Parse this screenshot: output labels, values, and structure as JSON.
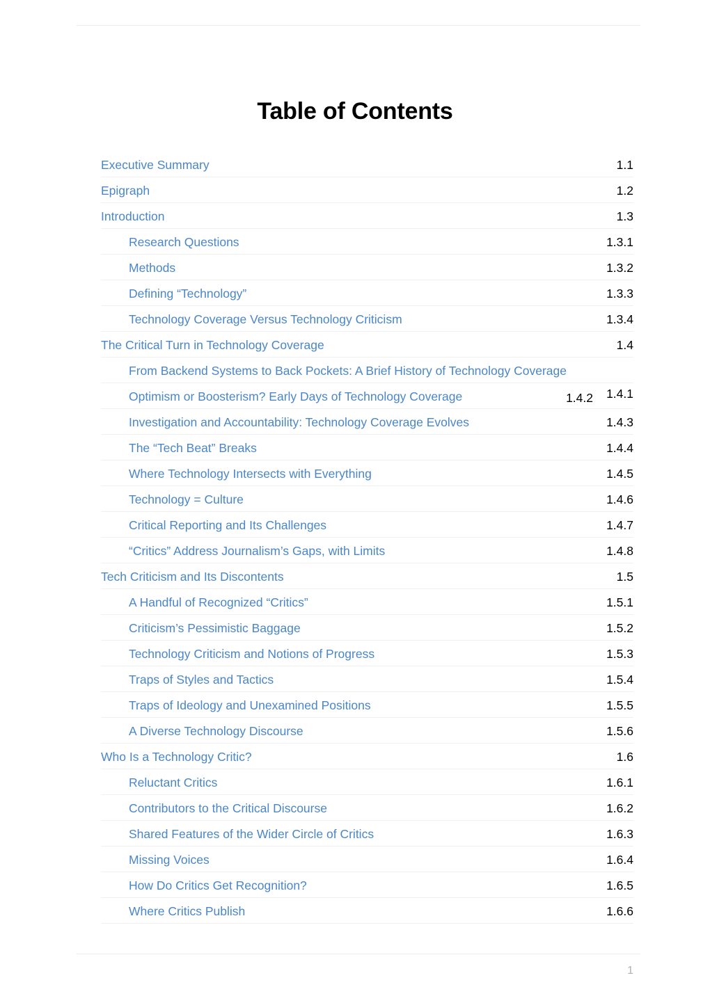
{
  "document": {
    "title": "Table of Contents",
    "page_number": "1"
  },
  "toc": {
    "entries": [
      {
        "label": "Executive Summary",
        "number": "1.1",
        "level": 1
      },
      {
        "label": "Epigraph",
        "number": "1.2",
        "level": 1
      },
      {
        "label": "Introduction",
        "number": "1.3",
        "level": 1
      },
      {
        "label": "Research Questions",
        "number": "1.3.1",
        "level": 2
      },
      {
        "label": "Methods",
        "number": "1.3.2",
        "level": 2
      },
      {
        "label": "Defining “Technology”",
        "number": "1.3.3",
        "level": 2
      },
      {
        "label": "Technology Coverage Versus Technology Criticism",
        "number": "1.3.4",
        "level": 2
      },
      {
        "label": "The Critical Turn in Technology Coverage",
        "number": "1.4",
        "level": 1
      },
      {
        "label": "From Backend Systems to Back Pockets: A Brief History of Technology Coverage",
        "number": "1.4.1",
        "level": 2,
        "overflow": true
      },
      {
        "label": "Optimism or Boosterism? Early Days of Technology Coverage",
        "number": "1.4.2",
        "level": 2,
        "carries_orphan": "1.4.1"
      },
      {
        "label": "Investigation and Accountability: Technology Coverage Evolves",
        "number": "1.4.3",
        "level": 2
      },
      {
        "label": "The “Tech Beat” Breaks",
        "number": "1.4.4",
        "level": 2
      },
      {
        "label": "Where Technology Intersects with Everything",
        "number": "1.4.5",
        "level": 2
      },
      {
        "label": "Technology = Culture",
        "number": "1.4.6",
        "level": 2
      },
      {
        "label": "Critical Reporting and Its Challenges",
        "number": "1.4.7",
        "level": 2
      },
      {
        "label": "“Critics” Address Journalism’s Gaps, with Limits",
        "number": "1.4.8",
        "level": 2
      },
      {
        "label": "Tech Criticism and Its Discontents",
        "number": "1.5",
        "level": 1
      },
      {
        "label": "A Handful of Recognized “Critics”",
        "number": "1.5.1",
        "level": 2
      },
      {
        "label": "Criticism’s Pessimistic Baggage",
        "number": "1.5.2",
        "level": 2
      },
      {
        "label": "Technology Criticism and Notions of Progress",
        "number": "1.5.3",
        "level": 2
      },
      {
        "label": "Traps of Styles and Tactics",
        "number": "1.5.4",
        "level": 2
      },
      {
        "label": "Traps of Ideology and Unexamined Positions",
        "number": "1.5.5",
        "level": 2
      },
      {
        "label": "A Diverse Technology Discourse",
        "number": "1.5.6",
        "level": 2
      },
      {
        "label": "Who Is a Technology Critic?",
        "number": "1.6",
        "level": 1
      },
      {
        "label": "Reluctant Critics",
        "number": "1.6.1",
        "level": 2
      },
      {
        "label": "Contributors to the Critical Discourse",
        "number": "1.6.2",
        "level": 2
      },
      {
        "label": "Shared Features of the Wider Circle of Critics",
        "number": "1.6.3",
        "level": 2
      },
      {
        "label": "Missing Voices",
        "number": "1.6.4",
        "level": 2
      },
      {
        "label": "How Do Critics Get Recognition?",
        "number": "1.6.5",
        "level": 2
      },
      {
        "label": "Where Critics Publish",
        "number": "1.6.6",
        "level": 2
      }
    ]
  },
  "colors": {
    "link": "#4a86c8",
    "number": "#000000",
    "rule": "#ebebeb",
    "row_separator": "#f0f0f0",
    "page_number": "#b0b0b0"
  }
}
